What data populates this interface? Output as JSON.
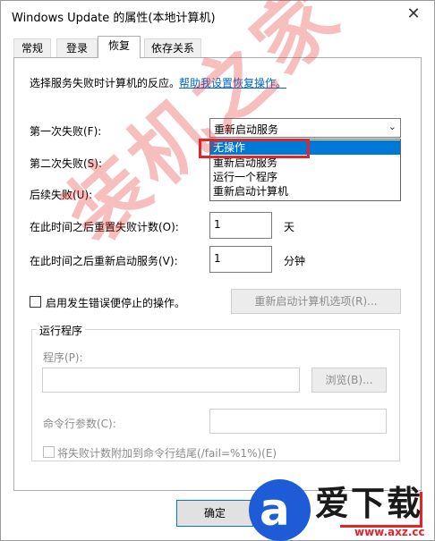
{
  "window": {
    "title": "Windows Update 的属性(本地计算机)",
    "close_glyph": "✕"
  },
  "tabs": [
    {
      "label": "常规",
      "active": false
    },
    {
      "label": "登录",
      "active": false
    },
    {
      "label": "恢复",
      "active": true
    },
    {
      "label": "依存关系",
      "active": false
    }
  ],
  "recovery": {
    "intro": "选择服务失败时计算机的反应。",
    "help_link": "帮助我设置恢复操作。",
    "first_failure_label": "第一次失败(F):",
    "first_failure_value": "重新启动服务",
    "second_failure_label": "第二次失败(S):",
    "subsequent_failure_label": "后续失败(U):",
    "dropdown_options": [
      "无操作",
      "重新启动服务",
      "运行一个程序",
      "重新启动计算机"
    ],
    "dropdown_highlighted": "无操作",
    "reset_count_label": "在此时间之后重置失败计数(O):",
    "reset_count_value": "1",
    "reset_count_unit": "天",
    "restart_service_label": "在此时间之后重新启动服务(V):",
    "restart_service_value": "1",
    "restart_service_unit": "分钟",
    "stop_with_errors_label": "启用发生错误便停止的操作。",
    "restart_computer_options_button": "重新启动计算机选项(R)...",
    "run_program_group": "运行程序",
    "program_label": "程序(P):",
    "browse_button": "浏览(B)...",
    "cmdline_label": "命令行参数(C):",
    "append_fail_count_label": "将失败计数附加到命令行结尾(/fail=%1%)(E)"
  },
  "footer": {
    "ok_button": "确定"
  },
  "watermark": {
    "text": "装机之家"
  },
  "logo": {
    "letter": "a",
    "name": "爱下载",
    "url": "www.axz.cc"
  },
  "colors": {
    "accent": "#0078d7",
    "highlight_box": "#e1252a",
    "link": "#0066cc",
    "logo_blue": "#1e5bd6"
  }
}
